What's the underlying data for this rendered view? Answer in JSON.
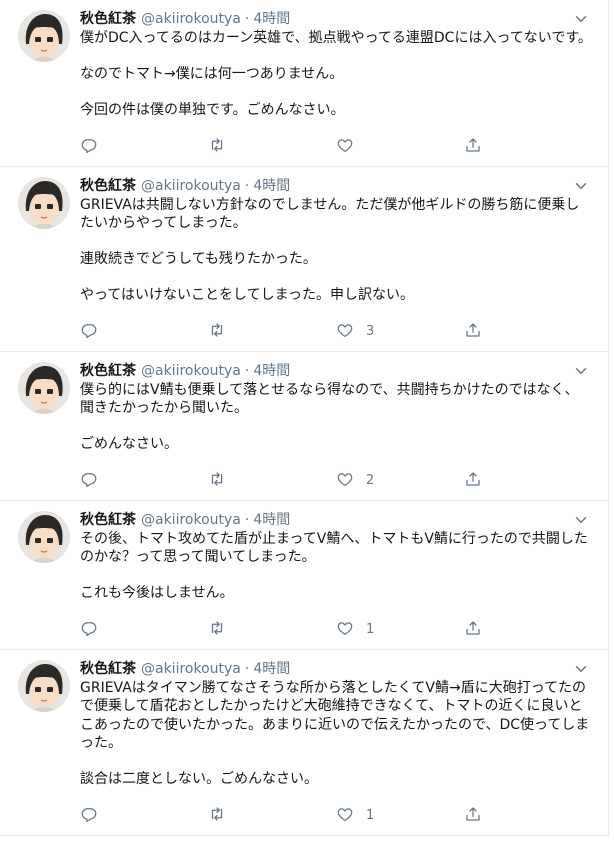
{
  "tweets": [
    {
      "name": "秋色紅茶",
      "handle": "@akiirokoutya",
      "dot": "·",
      "time": "4時間",
      "paragraphs": [
        "僕がDC入ってるのはカーン英雄で、拠点戦やってる連盟DCには入ってないです。",
        "なのでトマト→僕には何一つありません。",
        "今回の件は僕の単独です。ごめんなさい。"
      ],
      "likes": ""
    },
    {
      "name": "秋色紅茶",
      "handle": "@akiirokoutya",
      "dot": "·",
      "time": "4時間",
      "paragraphs": [
        "GRIEVAは共闘しない方針なのでしません。ただ僕が他ギルドの勝ち筋に便乗したいからやってしまった。",
        "連敗続きでどうしても残りたかった。",
        "やってはいけないことをしてしまった。申し訳ない。"
      ],
      "likes": "3"
    },
    {
      "name": "秋色紅茶",
      "handle": "@akiirokoutya",
      "dot": "·",
      "time": "4時間",
      "paragraphs": [
        "僕ら的にはV鯖も便乗して落とせるなら得なので、共闘持ちかけたのではなく、聞きたかったから聞いた。",
        "ごめんなさい。"
      ],
      "likes": "2"
    },
    {
      "name": "秋色紅茶",
      "handle": "@akiirokoutya",
      "dot": "·",
      "time": "4時間",
      "paragraphs": [
        "その後、トマト攻めてた盾が止まってV鯖へ、トマトもV鯖に行ったので共闘したのかな？って思って聞いてしまった。",
        "これも今後はしません。"
      ],
      "likes": "1"
    },
    {
      "name": "秋色紅茶",
      "handle": "@akiirokoutya",
      "dot": "·",
      "time": "4時間",
      "paragraphs": [
        "GRIEVAはタイマン勝てなさそうな所から落としたくてV鯖→盾に大砲打ってたので便乗して盾花おとしたかったけど大砲維持できなくて、トマトの近くに良いとこあったので使いたかった。あまりに近いので伝えたかったので、DC使ってしまった。",
        "談合は二度としない。ごめんなさい。"
      ],
      "likes": "1"
    }
  ],
  "icons": {
    "reply": "reply-icon",
    "retweet": "retweet-icon",
    "like": "heart-icon",
    "share": "share-icon",
    "caret": "chevron-down-icon"
  },
  "colors": {
    "text": "#14171a",
    "secondary": "#657786",
    "divider": "#e6ecf0"
  }
}
